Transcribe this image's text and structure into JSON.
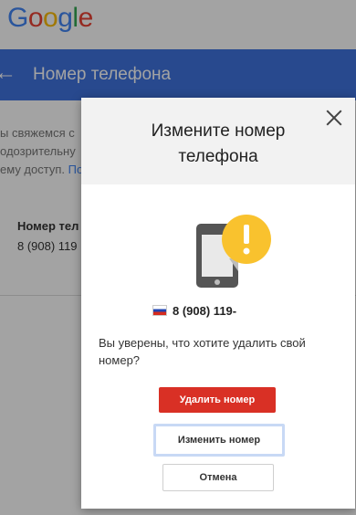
{
  "logo": {
    "letters": [
      "G",
      "o",
      "o",
      "g",
      "l",
      "e"
    ],
    "colors": [
      "#4285f4",
      "#ea4335",
      "#fbbc05",
      "#4285f4",
      "#34a853",
      "#ea4335"
    ]
  },
  "appbar": {
    "title": "Номер телефона",
    "color": "#3f73de"
  },
  "background_content": {
    "line1": "ы свяжемся с",
    "line2": "одозрительну",
    "line3": "ему доступ.",
    "link": "По",
    "phone_label": "Номер тел",
    "phone_value": "8 (908) 119"
  },
  "dialog": {
    "title": "Измените номер телефона",
    "number": "8 (908) 119-",
    "question": "Вы уверены, что хотите удалить свой номер?",
    "delete_button": "Удалить номер",
    "change_button": "Изменить номер",
    "cancel_button": "Отмена",
    "delete_color": "#d93025"
  },
  "icons": {
    "back": "arrow-left-icon",
    "close": "close-icon",
    "warning": "phone-warning-icon",
    "flag": "russia-flag-icon"
  }
}
